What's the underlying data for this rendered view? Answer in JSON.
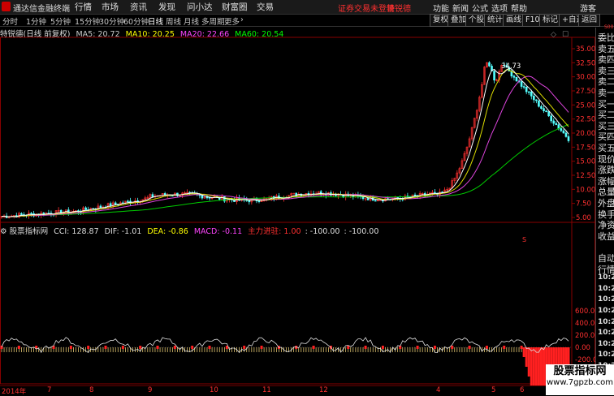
{
  "menubar": {
    "app_title": "通达信金融终端",
    "items": [
      "行情",
      "市场",
      "资讯",
      "发现",
      "问小达",
      "财富圈",
      "交易"
    ],
    "notice": "证券交易未登录",
    "stock_name": "特锐德",
    "right_items": [
      "功能",
      "新闻",
      "公式",
      "选项",
      "帮助"
    ],
    "guest": "游客"
  },
  "periodbar": {
    "periods": [
      "分时",
      "1分钟",
      "5分钟",
      "15分钟",
      "30分钟",
      "60分钟",
      "日线",
      "周线",
      "月线",
      "多周期",
      "更多"
    ],
    "active": "日线",
    "more_arrow": "›",
    "tools": [
      "复权",
      "叠加",
      "个股",
      "统计",
      "画线",
      "F10",
      "标记",
      "+自选",
      "返回"
    ]
  },
  "chart_info": {
    "title": "特锐德(日线 前复权)",
    "ma5_label": "MA5: 20.72",
    "ma10_label": "MA10: 20.25",
    "ma20_label": "MA20: 22.66",
    "ma60_label": "MA60: 20.54",
    "colors": {
      "ma5": "#ffffff",
      "ma10": "#ffff00",
      "ma20": "#ff44ff",
      "ma60": "#00ff00"
    }
  },
  "indicator_info": {
    "title": "股票指标网",
    "cci": "CCI: 128.87",
    "dif": "DIF: -1.01",
    "dea": "DEA: -0.86",
    "macd": "MACD: -0.11",
    "zljq": "主力进驻: 1.00",
    "v1": ": -100.00",
    "v2": ": -100.00"
  },
  "price_axis": [
    "35.00",
    "32.50",
    "30.00",
    "27.50",
    "25.00",
    "22.50",
    "20.00",
    "17.50",
    "15.00",
    "12.50",
    "10.00",
    "7.50",
    "5.00"
  ],
  "indicator_axis": [
    "600.0",
    "400.0",
    "200.0",
    "0.00",
    "-200.0",
    "-400.0"
  ],
  "peak_label": "34.73",
  "date_axis": [
    "2014年",
    "7",
    "8",
    "9",
    "10",
    "11",
    "12",
    "4",
    "5",
    "6"
  ],
  "right_panel": {
    "items": [
      "委比",
      "卖五",
      "卖四",
      "卖三",
      "卖二",
      "卖一",
      "买一",
      "买二",
      "买三",
      "买四",
      "买五",
      "现价",
      "涨跌",
      "涨幅",
      "总量",
      "外盘",
      "换手",
      "净资",
      "收益",
      "",
      "自动",
      "行情",
      "10:20",
      "10:20",
      "10:20",
      "10:20",
      "10:20",
      "10:20",
      "10:20",
      "10:20",
      "10:20"
    ],
    "top_mark": "S00"
  },
  "watermark": {
    "line1": "股票指标网",
    "line2": "www.7gpzb.com"
  },
  "volume_marker": "S"
}
